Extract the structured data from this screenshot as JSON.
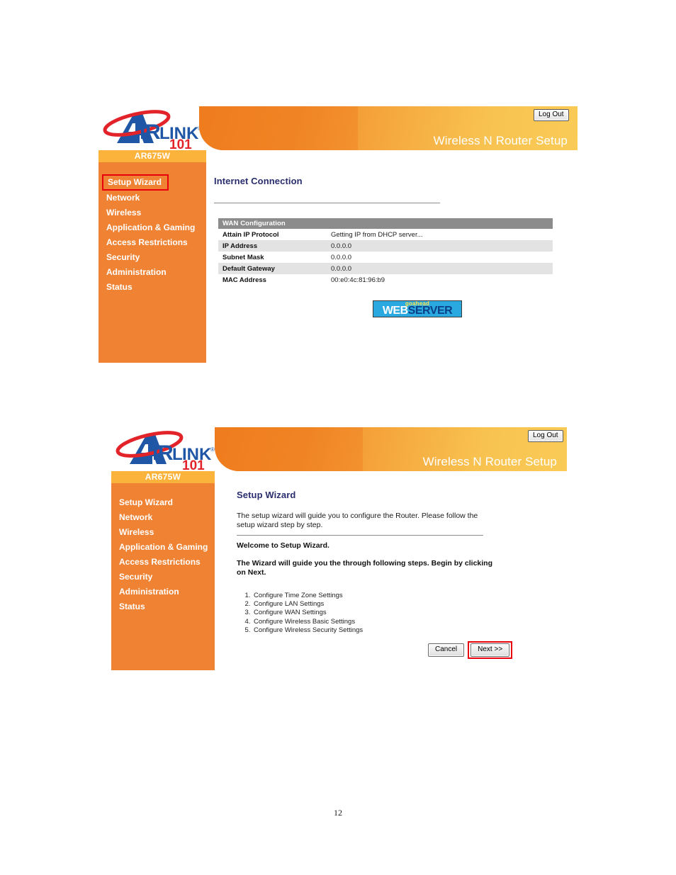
{
  "document": {
    "page_number": "12"
  },
  "brand": {
    "logo_main": "IRLINK",
    "logo_lead": "A",
    "logo_sub": "101",
    "logo_registered": "®"
  },
  "figure1": {
    "header": {
      "title": "Wireless N Router Setup",
      "logout_label": "Log Out"
    },
    "sidebar": {
      "model": "AR675W",
      "items": [
        {
          "label": "Setup Wizard",
          "highlighted": true
        },
        {
          "label": "Network",
          "highlighted": false
        },
        {
          "label": "Wireless",
          "highlighted": false
        },
        {
          "label": "Application & Gaming",
          "highlighted": false
        },
        {
          "label": "Access Restrictions",
          "highlighted": false
        },
        {
          "label": "Security",
          "highlighted": false
        },
        {
          "label": "Administration",
          "highlighted": false
        },
        {
          "label": "Status",
          "highlighted": false
        }
      ]
    },
    "content": {
      "heading": "Internet Connection",
      "table": {
        "caption": "WAN Configuration",
        "rows": [
          {
            "label": "Attain IP Protocol",
            "value": "Getting IP from DHCP server..."
          },
          {
            "label": "IP Address",
            "value": "0.0.0.0"
          },
          {
            "label": "Subnet Mask",
            "value": "0.0.0.0"
          },
          {
            "label": "Default Gateway",
            "value": "0.0.0.0"
          },
          {
            "label": "MAC Address",
            "value": "00:e0:4c:81:96:b9"
          }
        ]
      },
      "webserver_logo": {
        "top_word": "goahead",
        "part1": "WEB",
        "part2": "SERVER"
      }
    }
  },
  "figure2": {
    "header": {
      "title": "Wireless N Router Setup",
      "logout_label": "Log Out"
    },
    "sidebar": {
      "model": "AR675W",
      "items": [
        {
          "label": "Setup Wizard",
          "highlighted": false
        },
        {
          "label": "Network",
          "highlighted": false
        },
        {
          "label": "Wireless",
          "highlighted": false
        },
        {
          "label": "Application & Gaming",
          "highlighted": false
        },
        {
          "label": "Access Restrictions",
          "highlighted": false
        },
        {
          "label": "Security",
          "highlighted": false
        },
        {
          "label": "Administration",
          "highlighted": false
        },
        {
          "label": "Status",
          "highlighted": false
        }
      ]
    },
    "content": {
      "heading": "Setup Wizard",
      "intro": "The setup wizard will guide you to configure the Router. Please follow the setup wizard step by step.",
      "welcome": "Welcome to Setup Wizard.",
      "instruction": "The Wizard will guide you the through following steps. Begin by clicking on Next.",
      "steps": [
        "Configure Time Zone Settings",
        "Configure LAN Settings",
        "Configure WAN Settings",
        "Configure Wireless Basic Settings",
        "Configure Wireless Security Settings"
      ],
      "buttons": {
        "cancel_label": "Cancel",
        "next_label": "Next >>"
      }
    }
  }
}
